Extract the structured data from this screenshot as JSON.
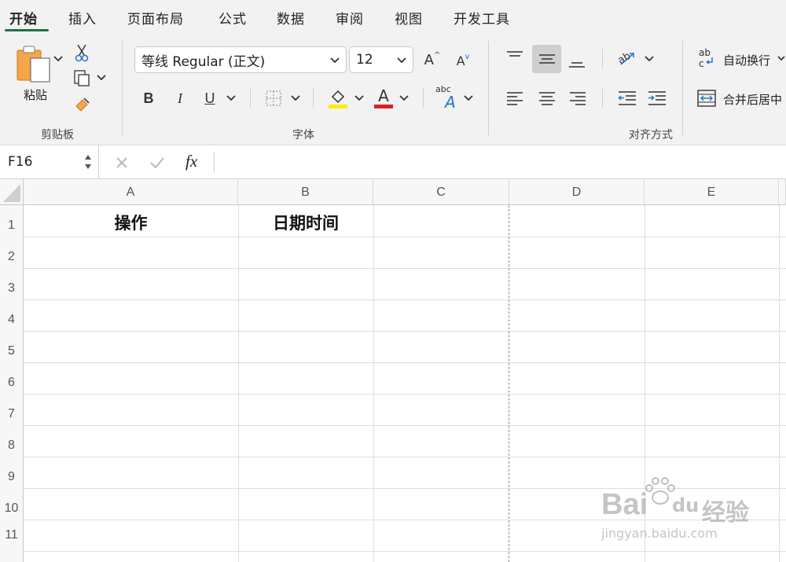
{
  "tabs": [
    "开始",
    "插入",
    "页面布局",
    "公式",
    "数据",
    "审阅",
    "视图",
    "开发工具"
  ],
  "ribbon": {
    "clipboard": {
      "paste_label": "粘贴",
      "group_label": "剪贴板"
    },
    "font": {
      "font_name": "等线 Regular (正文)",
      "font_size": "12",
      "group_label": "字体",
      "bold": "B",
      "italic": "I",
      "underline": "U",
      "font_color_letter": "A",
      "grow_font": "A",
      "shrink_font": "A",
      "phonetic_small": "abc",
      "phonetic_big": "A"
    },
    "alignment": {
      "wrap_text": "自动换行",
      "merge_center": "合并后居中",
      "group_label": "对齐方式"
    }
  },
  "formula_bar": {
    "name_box": "F16",
    "fx": "fx",
    "value": ""
  },
  "sheet": {
    "columns": [
      "A",
      "B",
      "C",
      "D",
      "E"
    ],
    "rows": [
      "1",
      "2",
      "3",
      "4",
      "5",
      "6",
      "7",
      "8",
      "9",
      "10",
      "11"
    ],
    "cells": {
      "A1": "操作",
      "B1": "日期时间"
    }
  },
  "watermark": {
    "brand": "Bai",
    "du": "du",
    "jingyan": "经验",
    "url": "jingyan.baidu.com"
  },
  "colors": {
    "accent": "#1e7145",
    "highlight_yellow": "#ffeb00",
    "font_red": "#e02020",
    "wrap_icon_blue": "#2a72c8"
  }
}
